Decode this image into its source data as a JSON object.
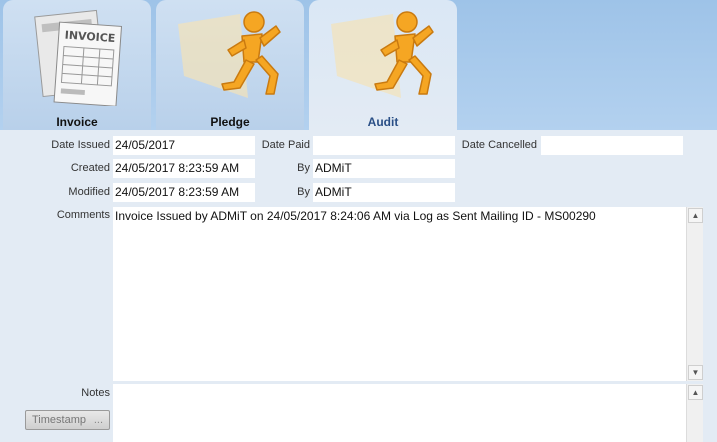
{
  "tabs": [
    {
      "label": "Invoice",
      "icon": "invoice-document-icon",
      "active": false
    },
    {
      "label": "Pledge",
      "icon": "running-man-icon",
      "active": false
    },
    {
      "label": "Audit",
      "icon": "running-man-icon",
      "active": true
    }
  ],
  "invoice_icon_text": "INVOICE",
  "fields": {
    "date_issued": {
      "label": "Date Issued",
      "value": "24/05/2017"
    },
    "date_paid": {
      "label": "Date Paid",
      "value": ""
    },
    "date_cancelled": {
      "label": "Date Cancelled",
      "value": ""
    },
    "created": {
      "label": "Created",
      "value": "24/05/2017 8:23:59 AM"
    },
    "created_by": {
      "label": "By",
      "value": "ADMiT"
    },
    "modified": {
      "label": "Modified",
      "value": "24/05/2017 8:23:59 AM"
    },
    "modified_by": {
      "label": "By",
      "value": "ADMiT"
    },
    "comments": {
      "label": "Comments",
      "value": "Invoice Issued by ADMiT on 24/05/2017 8:24:06 AM via Log as Sent Mailing ID - MS00290"
    },
    "notes": {
      "label": "Notes",
      "value": ""
    }
  },
  "timestamp_button": {
    "label": "Timestamp",
    "suffix": "..."
  },
  "colors": {
    "accent": "#2a4f86",
    "tab_bar": "#a9c9ea",
    "panel": "#e3ebf4",
    "runner": "#f5a623"
  }
}
